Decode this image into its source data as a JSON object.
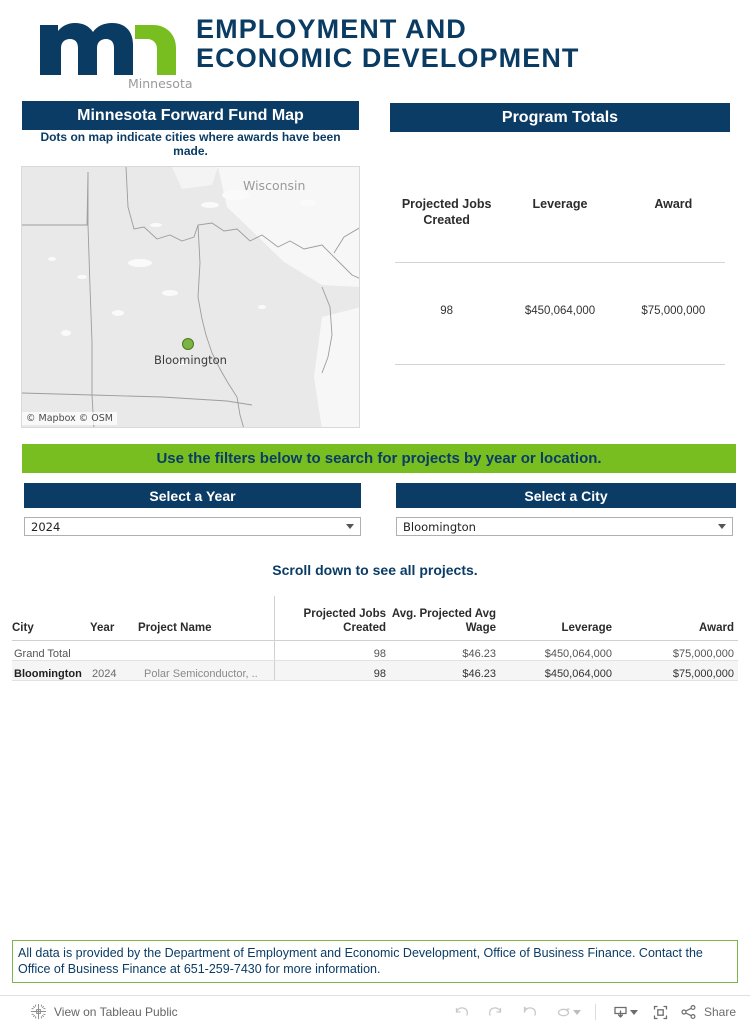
{
  "header": {
    "logo_alt": "mn-logo",
    "line1": "EMPLOYMENT AND",
    "line2": "ECONOMIC DEVELOPMENT"
  },
  "map_panel": {
    "title": "Minnesota Forward Fund Map",
    "subtitle": "Dots on map indicate cities where awards have been made.",
    "state_labels": [
      "Minnesota",
      "Wisconsin"
    ],
    "dot_city": "Bloomington",
    "attribution": "© Mapbox  © OSM"
  },
  "totals_panel": {
    "title": "Program Totals",
    "headers": [
      "Projected Jobs Created",
      "Leverage",
      "Award"
    ],
    "values": [
      "98",
      "$450,064,000",
      "$75,000,000"
    ]
  },
  "filters": {
    "banner": "Use the filters below to search for projects by year or location.",
    "year_label": "Select a Year",
    "year_value": "2024",
    "city_label": "Select a City",
    "city_value": "Bloomington"
  },
  "table": {
    "scroll_hint": "Scroll down to see all projects.",
    "headers": {
      "city": "City",
      "year": "Year",
      "project": "Project Name",
      "jobs": "Projected Jobs Created",
      "wage": "Avg. Projected Avg Wage",
      "leverage": "Leverage",
      "award": "Award"
    },
    "rows": [
      {
        "city": "Grand Total",
        "year": "",
        "project": "",
        "jobs": "98",
        "wage": "$46.23",
        "leverage": "$450,064,000",
        "award": "$75,000,000"
      },
      {
        "city": "Bloomington",
        "year": "2024",
        "project": "Polar Semiconductor, ..",
        "jobs": "98",
        "wage": "$46.23",
        "leverage": "$450,064,000",
        "award": "$75,000,000"
      }
    ]
  },
  "footnote": {
    "text": "All data is provided by the Department of Employment and Economic Development, Office of Business Finance. Contact the Office of Business Finance at 651-259-7430 for more information."
  },
  "toolbar": {
    "view_label": "View on Tableau Public",
    "share_label": "Share"
  },
  "colors": {
    "navy": "#0a3c66",
    "green": "#78be21",
    "dot_green": "#7cb342",
    "footnote_border": "#7ab648"
  }
}
